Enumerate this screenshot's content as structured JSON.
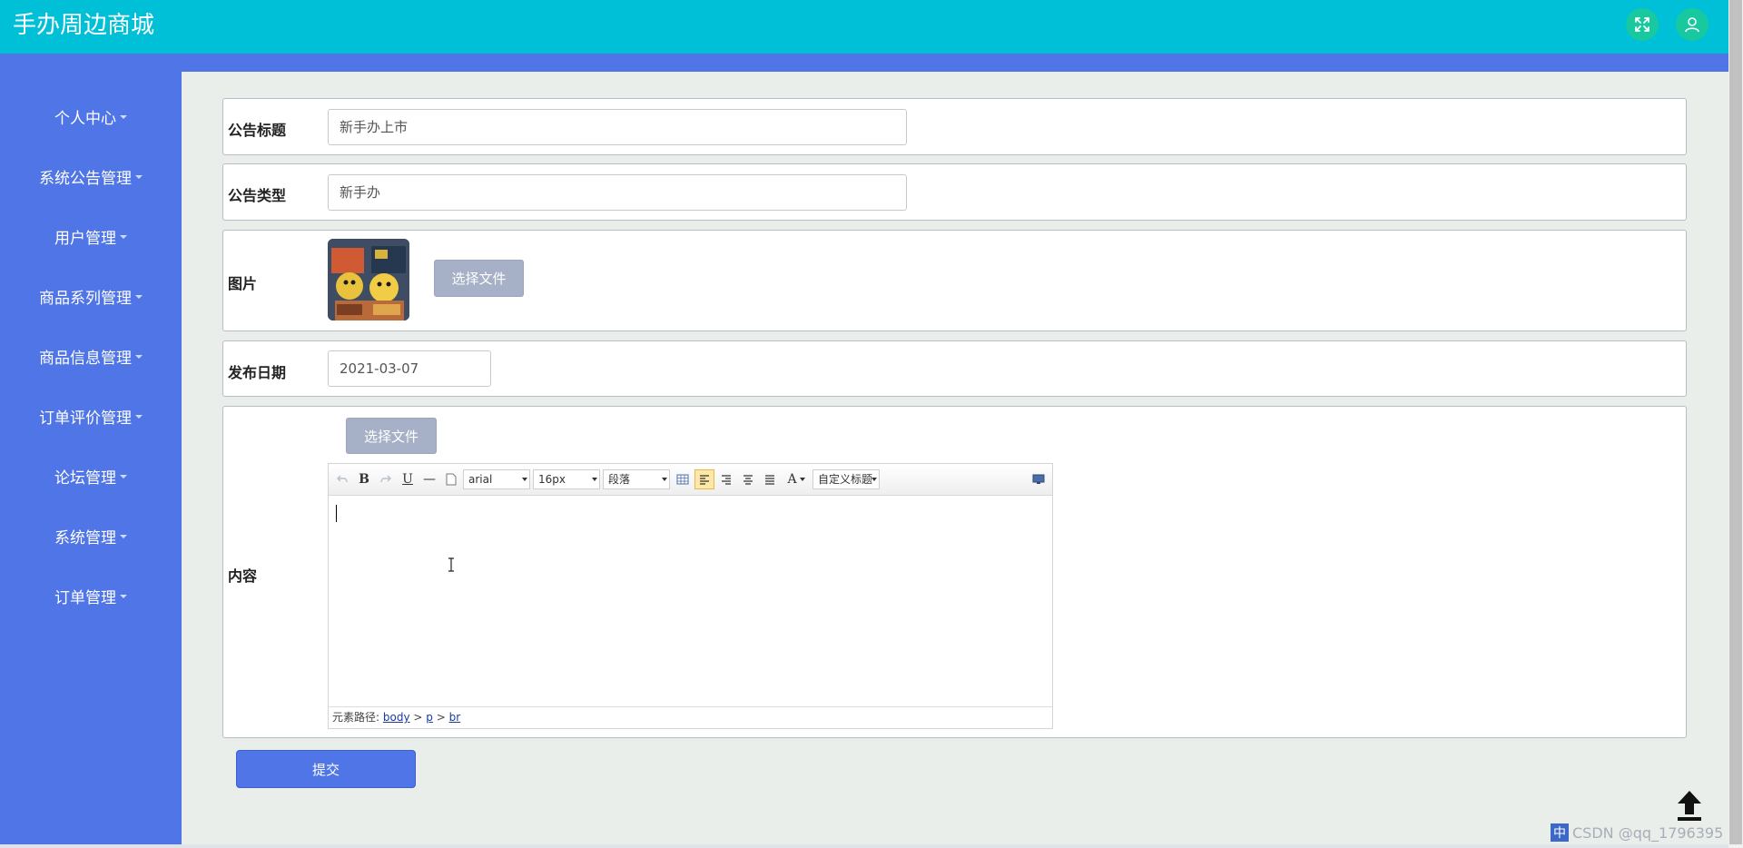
{
  "header": {
    "title": "手办周边商城",
    "fullscreen_icon": "expand-arrows-icon",
    "user_icon": "user-icon"
  },
  "colors": {
    "header": "#00c0d8",
    "sidebar": "#5075e6",
    "icon_bg": "#18c9a0",
    "main_bg": "#e9eeea",
    "file_button": "#a6b1c7"
  },
  "sidebar": {
    "items": [
      {
        "label": "个人中心"
      },
      {
        "label": "系统公告管理"
      },
      {
        "label": "用户管理"
      },
      {
        "label": "商品系列管理"
      },
      {
        "label": "商品信息管理"
      },
      {
        "label": "订单评价管理"
      },
      {
        "label": "论坛管理"
      },
      {
        "label": "系统管理"
      },
      {
        "label": "订单管理"
      }
    ]
  },
  "form": {
    "title": {
      "label": "公告标题",
      "value": "新手办上市"
    },
    "type": {
      "label": "公告类型",
      "value": "新手办"
    },
    "image": {
      "label": "图片",
      "button": "选择文件"
    },
    "date": {
      "label": "发布日期",
      "value": "2021-03-07"
    },
    "content": {
      "label": "内容",
      "file_button": "选择文件",
      "toolbar": {
        "undo_icon": "undo-icon",
        "bold": "B",
        "redo_icon": "redo-icon",
        "underline": "U",
        "hr": "—",
        "font_family": "arial",
        "font_size": "16px",
        "paragraph": "段落",
        "font_color": "A",
        "custom_title": "自定义标题"
      },
      "path_label": "元素路径:",
      "path": [
        "body",
        "p",
        "br"
      ],
      "path_sep": ">"
    },
    "submit": "提交"
  },
  "tray": {
    "ime": "中",
    "watermark": "CSDN @qq_1796395"
  }
}
